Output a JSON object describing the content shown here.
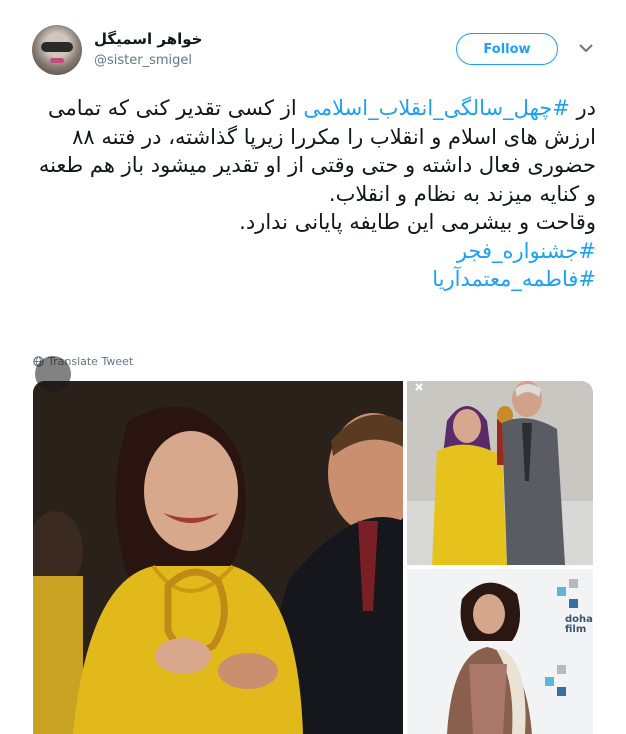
{
  "user": {
    "name": "خواهر اسمیگل",
    "handle": "@sister_smigel",
    "avatar_icon": "avatar-image"
  },
  "actions": {
    "follow_label": "Follow",
    "menu_icon": "chevron-down-icon"
  },
  "tweet": {
    "line1_prefix": "در ",
    "hashtag1": "#چهل_سالگی_انقلاب_اسلامی",
    "line1_rest": " از کسی تقدیر کنی که تمامی ارزش های اسلام و انقلاب را مکررا زیرپا گذاشته، در فتنه ۸۸ حضوری فعال داشته و حتی وقتی از او تقدیر میشود باز هم طعنه و کنایه میزند به نظام و انقلاب.",
    "line2": "وقاحت و بیشرمی این طایفه پایانی ندارد.",
    "hashtag2": "#جشنواره_فجر",
    "hashtag3": "#فاطمه_معتمدآریا"
  },
  "translate": {
    "label": "Translate Tweet",
    "icon": "globe-icon"
  },
  "media": {
    "main_image": "award-ceremony-photo",
    "top_right_image": "award-stage-photo",
    "bottom_right_image": "doha-film-event-photo",
    "close_icon": "close-icon",
    "doha_logo_text": "doha film"
  },
  "colors": {
    "link": "#1da1f2",
    "text": "#14171a",
    "secondary": "#657786"
  }
}
